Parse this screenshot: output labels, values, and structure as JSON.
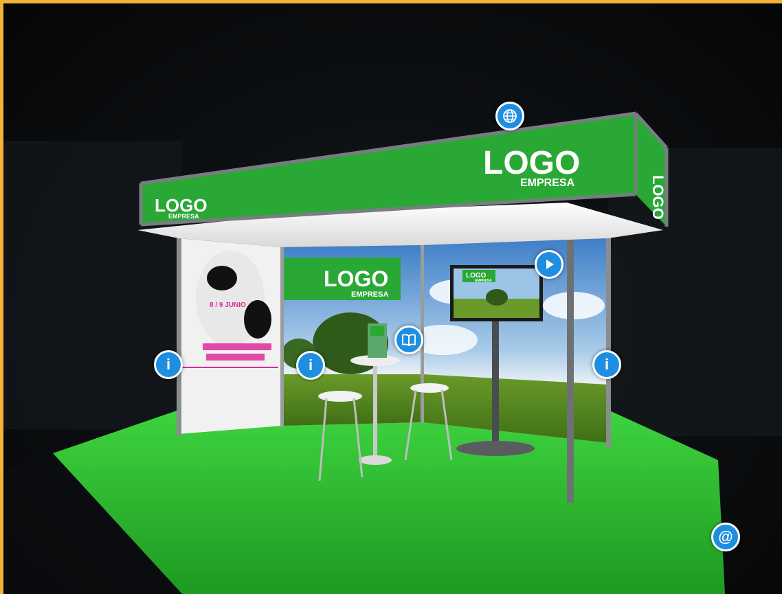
{
  "colors": {
    "frame_border": "#f5b335",
    "brand_green": "#2aa836",
    "hotspot_blue": "#1e8ee0",
    "floor_green": "#35c93a"
  },
  "booth": {
    "header_logo": "LOGO",
    "header_sub": "EMPRESA",
    "small_logo": "LOGO",
    "small_sub": "EMPRESA",
    "wall_logo": "LOGO",
    "wall_sub": "EMPRESA",
    "side_logo": "LOGO",
    "screen_logo": "LOGO",
    "screen_sub": "EMPRESA",
    "poster_date": "8 / 9 JUNIO"
  },
  "hotspots": {
    "website": {
      "icon": "globe-icon"
    },
    "video": {
      "icon": "play-icon"
    },
    "brochure": {
      "icon": "book-icon"
    },
    "info_left": {
      "icon": "info-icon",
      "label": "i"
    },
    "info_center": {
      "icon": "info-icon",
      "label": "i"
    },
    "info_right": {
      "icon": "info-icon",
      "label": "i"
    },
    "email": {
      "icon": "at-icon",
      "label": "@"
    }
  }
}
